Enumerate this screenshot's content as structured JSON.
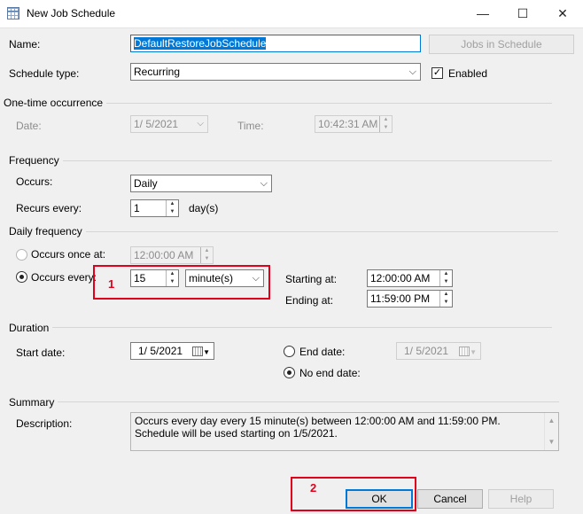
{
  "window": {
    "title": "New Job Schedule",
    "minimize": "—",
    "maximize": "☐",
    "close": "✕"
  },
  "name": {
    "label": "Name:",
    "value": "DefaultRestoreJobSchedule",
    "jobs_button": "Jobs in Schedule"
  },
  "schedule_type": {
    "label": "Schedule type:",
    "value": "Recurring",
    "enabled_label": "Enabled",
    "enabled_checked": true
  },
  "one_time": {
    "title": "One-time occurrence",
    "date_label": "Date:",
    "date_value": "1/  5/2021",
    "time_label": "Time:",
    "time_value": "10:42:31 AM"
  },
  "frequency": {
    "title": "Frequency",
    "occurs_label": "Occurs:",
    "occurs_value": "Daily",
    "recurs_label": "Recurs every:",
    "recurs_value": "1",
    "recurs_unit": "day(s)"
  },
  "daily_frequency": {
    "title": "Daily frequency",
    "once_label": "Occurs once at:",
    "once_value": "12:00:00 AM",
    "every_label": "Occurs every:",
    "every_value": "15",
    "every_unit": "minute(s)",
    "starting_label": "Starting at:",
    "starting_value": "12:00:00 AM",
    "ending_label": "Ending at:",
    "ending_value": "11:59:00 PM"
  },
  "duration": {
    "title": "Duration",
    "start_label": "Start date:",
    "start_value": "1/  5/2021",
    "end_label": "End date:",
    "end_value": "1/  5/2021",
    "no_end_label": "No end date:"
  },
  "summary": {
    "title": "Summary",
    "desc_label": "Description:",
    "desc_text": "Occurs every day every 15 minute(s) between 12:00:00 AM and 11:59:00 PM. Schedule will be used starting on 1/5/2021."
  },
  "buttons": {
    "ok": "OK",
    "cancel": "Cancel",
    "help": "Help"
  },
  "annotations": {
    "one": "1",
    "two": "2"
  },
  "colors": {
    "highlight": "#e0001b",
    "selection": "#0078d7"
  }
}
